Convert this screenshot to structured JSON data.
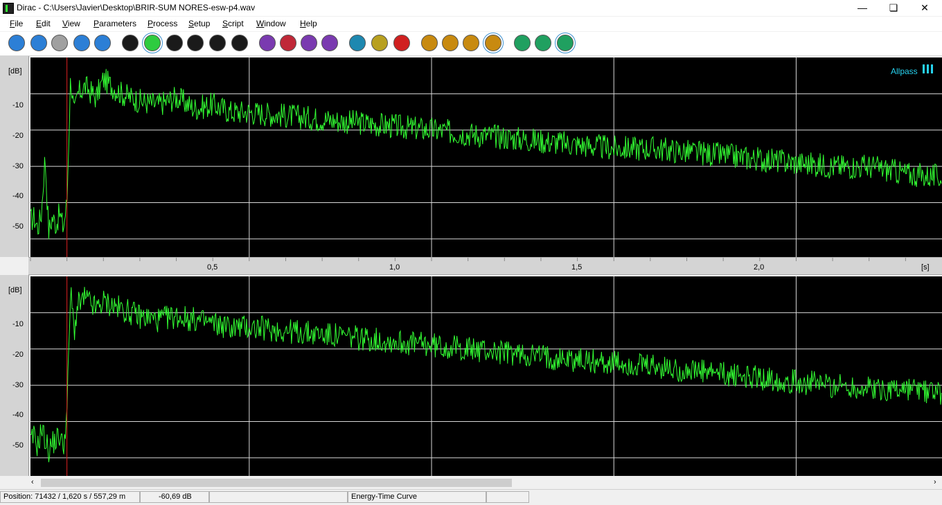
{
  "window": {
    "title": "Dirac - C:\\Users\\Javier\\Desktop\\BRIR-SUM NORES-esw-p4.wav"
  },
  "menu": [
    "File",
    "Edit",
    "View",
    "Parameters",
    "Process",
    "Setup",
    "Script",
    "Window",
    "Help"
  ],
  "menu_underline": [
    "F",
    "E",
    "V",
    "P",
    "P",
    "S",
    "S",
    "W",
    "H"
  ],
  "toolbar": {
    "buttons": [
      {
        "name": "new-icon",
        "color": "#2c7fd6"
      },
      {
        "name": "open-icon",
        "color": "#2c7fd6"
      },
      {
        "name": "save-icon",
        "color": "#a0a0a0"
      },
      {
        "name": "print-icon",
        "color": "#2c7fd6"
      },
      {
        "name": "close-file-icon",
        "color": "#2c7fd6"
      },
      {
        "name": "impulse-icon",
        "color": "#1a1a1a"
      },
      {
        "name": "energy-time-icon",
        "color": "#2ecc40"
      },
      {
        "name": "curve-icon",
        "color": "#1a1a1a"
      },
      {
        "name": "decay-icon",
        "color": "#1a1a1a"
      },
      {
        "name": "bars-icon",
        "color": "#1a1a1a"
      },
      {
        "name": "phase-icon",
        "color": "#1a1a1a"
      },
      {
        "name": "spectrum-icon",
        "color": "#7a3ab0"
      },
      {
        "name": "filter-icon",
        "color": "#c02838"
      },
      {
        "name": "grid-icon",
        "color": "#7a3ab0"
      },
      {
        "name": "signal-icon",
        "color": "#7a3ab0"
      },
      {
        "name": "arrow-icon",
        "color": "#1e88b0"
      },
      {
        "name": "columns-icon",
        "color": "#b8a020"
      },
      {
        "name": "cursor-icon",
        "color": "#d02020"
      },
      {
        "name": "zoom-in-icon",
        "color": "#c88a10"
      },
      {
        "name": "zoom-out-icon",
        "color": "#c88a10"
      },
      {
        "name": "zoom-fit-icon",
        "color": "#c88a10"
      },
      {
        "name": "zoom-vertical-icon",
        "color": "#c88a10"
      },
      {
        "name": "record-icon",
        "color": "#20a060"
      },
      {
        "name": "play-icon",
        "color": "#20a060"
      },
      {
        "name": "stop-icon",
        "color": "#20a060"
      }
    ]
  },
  "plot": {
    "filter_label": "Allpass",
    "y_unit": "[dB]",
    "y_ticks": [
      "-10",
      "-20",
      "-30",
      "-40",
      "-50"
    ],
    "x_unit": "[s]",
    "x_ticks": [
      "0,5",
      "1,0",
      "1,5",
      "2,0"
    ],
    "colors": {
      "trace": "#33ff33",
      "cursor": "#e02020",
      "grid": "#d8d8d8"
    }
  },
  "chart_data": [
    {
      "type": "line",
      "ylabel": "[dB]",
      "xlabel": "[s]",
      "xlim": [
        -0.1,
        2.4
      ],
      "ylim": [
        -55,
        0
      ],
      "cursor_x": 0.0,
      "series": [
        {
          "x": [
            -0.1,
            -0.09,
            -0.08,
            -0.07,
            -0.06,
            -0.05,
            -0.04,
            -0.03,
            -0.02,
            -0.01,
            0.0,
            0.01,
            0.02,
            0.03,
            0.05,
            0.08,
            0.1,
            0.15,
            0.2,
            0.25,
            0.3,
            0.35,
            0.4,
            0.45,
            0.5,
            0.6,
            0.7,
            0.8,
            0.9,
            1.0,
            1.1,
            1.2,
            1.3,
            1.4,
            1.5,
            1.6,
            1.7,
            1.8,
            1.9,
            2.0,
            2.1,
            2.2,
            2.3,
            2.4
          ],
          "values": [
            -45,
            -44,
            -47,
            -43,
            -27,
            -48,
            -44,
            -46,
            -43,
            -47,
            -40,
            -5,
            -16,
            -10,
            -8,
            -11,
            -6,
            -10,
            -12,
            -13,
            -11,
            -14,
            -13,
            -15,
            -15,
            -16,
            -17,
            -18,
            -19,
            -20,
            -21,
            -22,
            -23,
            -24,
            -25,
            -25,
            -26,
            -27,
            -28,
            -29,
            -30,
            -30,
            -32,
            -33
          ]
        }
      ]
    },
    {
      "type": "line",
      "ylabel": "[dB]",
      "xlabel": "[s]",
      "xlim": [
        -0.1,
        2.4
      ],
      "ylim": [
        -55,
        0
      ],
      "cursor_x": 0.0,
      "series": [
        {
          "x": [
            -0.1,
            -0.09,
            -0.08,
            -0.07,
            -0.06,
            -0.05,
            -0.04,
            -0.03,
            -0.02,
            -0.01,
            0.0,
            0.01,
            0.02,
            0.03,
            0.05,
            0.08,
            0.1,
            0.15,
            0.2,
            0.25,
            0.3,
            0.35,
            0.4,
            0.45,
            0.5,
            0.6,
            0.7,
            0.8,
            0.9,
            1.0,
            1.1,
            1.2,
            1.3,
            1.4,
            1.5,
            1.6,
            1.7,
            1.8,
            1.9,
            2.0,
            2.1,
            2.2,
            2.3,
            2.4
          ],
          "values": [
            -46,
            -44,
            -47,
            -42,
            -45,
            -48,
            -46,
            -45,
            -44,
            -47,
            -38,
            -4,
            -15,
            -8,
            -6,
            -9,
            -7,
            -9,
            -11,
            -12,
            -11,
            -12,
            -13,
            -14,
            -14,
            -15,
            -16,
            -17,
            -18,
            -19,
            -20,
            -21,
            -22,
            -23,
            -24,
            -25,
            -26,
            -27,
            -28,
            -29,
            -30,
            -31,
            -31,
            -32
          ]
        }
      ]
    }
  ],
  "status": {
    "position": "Position: 71432 / 1,620 s / 557,29 m",
    "level": "-60,69 dB",
    "empty1": "",
    "mode": "Energy-Time Curve",
    "empty2": ""
  }
}
